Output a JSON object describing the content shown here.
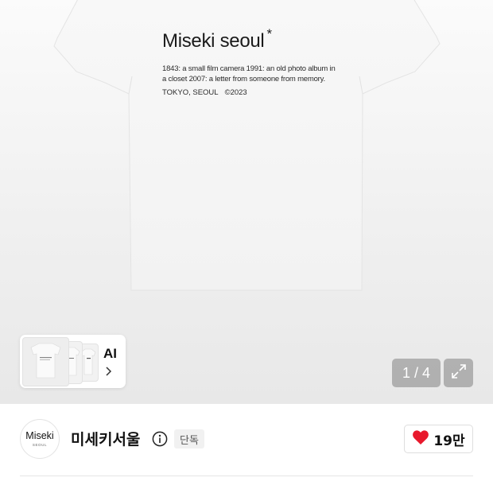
{
  "gallery": {
    "print": {
      "brand": "Miseki seoul",
      "star": "*",
      "tagline": "1843: a small film camera  1991: an old photo album in a closet  2007: a letter from someone from memory.",
      "location": "TOKYO, SEOUL",
      "year": "©2023"
    },
    "ai_chip": {
      "label": "AI",
      "icon": "chevron-right-icon"
    },
    "counter": "1 / 4",
    "expand_icon": "expand-icon"
  },
  "brand": {
    "logo_main": "Miseki",
    "logo_sub": "SEOUL",
    "name": "미세키서울",
    "info_icon": "info-icon",
    "tag": "단독"
  },
  "like": {
    "count": "19만",
    "icon": "heart-icon",
    "color": "#e8192c"
  }
}
